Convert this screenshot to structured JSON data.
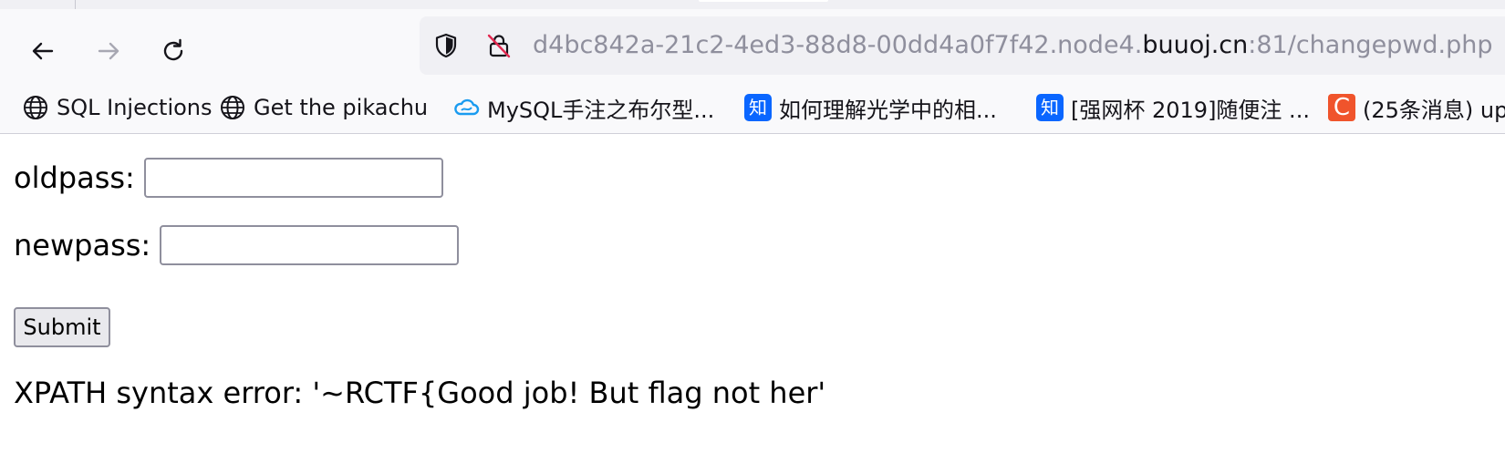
{
  "browser": {
    "nav": {
      "back_icon": "arrow-left-icon",
      "forward_icon": "arrow-right-icon",
      "reload_icon": "reload-icon"
    },
    "url": {
      "prefix": "d4bc842a-21c2-4ed3-88d8-00dd4a0f7f42.node4.",
      "domain": "buuoj.cn",
      "suffix": ":81/changepwd.php"
    },
    "bookmarks": [
      {
        "label": "SQL Injections",
        "icon": "globe-icon"
      },
      {
        "label": "Get the pikachu",
        "icon": "globe-icon"
      },
      {
        "label": "MySQL手注之布尔型...",
        "icon": "cloud-icon"
      },
      {
        "label": "如何理解光学中的相...",
        "icon": "zhihu-icon",
        "icon_text": "知"
      },
      {
        "label": "[强网杯 2019]随便注 ...",
        "icon": "zhihu-icon",
        "icon_text": "知"
      },
      {
        "label": "(25条消息) up",
        "icon": "csdn-icon",
        "icon_text": "C"
      }
    ],
    "colors": {
      "zhihu": "#0a66ff",
      "csdn": "#f0542c",
      "chrome_bg": "#f9f9fb",
      "urlbar_bg": "#f0f0f4"
    }
  },
  "page": {
    "oldpass_label": "oldpass:",
    "oldpass_value": "",
    "newpass_label": "newpass:",
    "newpass_value": "",
    "submit_label": "Submit",
    "error_message": "XPATH syntax error: '~RCTF{Good job! But flag not her'"
  }
}
